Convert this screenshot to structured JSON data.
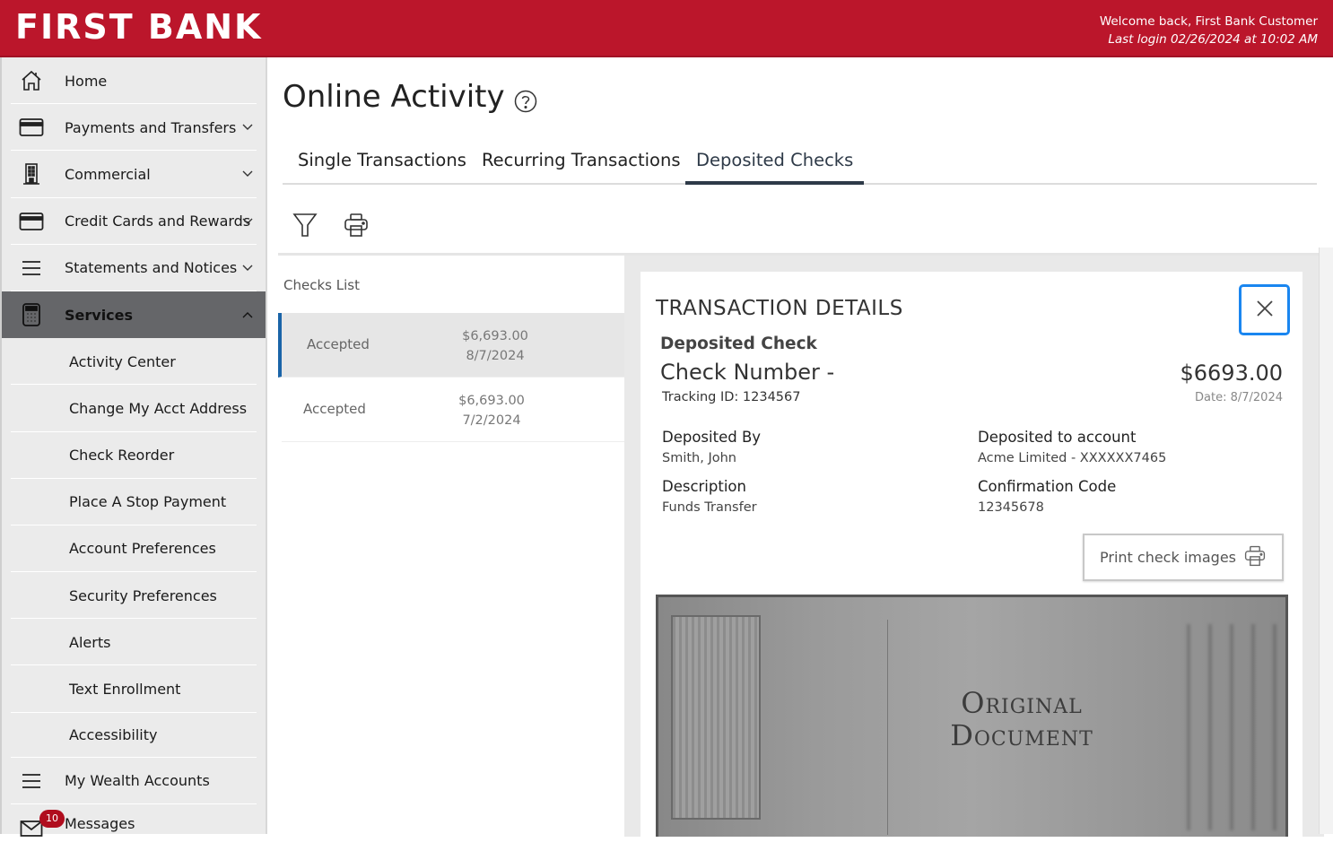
{
  "header": {
    "logo": "FIRST BANK",
    "welcome": "Welcome back, First Bank Customer",
    "last_login": "Last login 02/26/2024 at 10:02 AM",
    "brand_color": "#bb162b"
  },
  "sidebar": {
    "items": [
      {
        "label": "Home",
        "icon": "home-icon"
      },
      {
        "label": "Payments and Transfers",
        "icon": "card-icon",
        "chevron": "down"
      },
      {
        "label": "Commercial",
        "icon": "building-icon",
        "chevron": "down"
      },
      {
        "label": "Credit Cards and Rewards",
        "icon": "card-icon",
        "chevron": "down"
      },
      {
        "label": "Statements and Notices",
        "icon": "menu-icon",
        "chevron": "down"
      },
      {
        "label": "Services",
        "icon": "calculator-icon",
        "chevron": "up",
        "active": true
      }
    ],
    "services_sub": [
      {
        "label": "Activity Center"
      },
      {
        "label": "Change My Acct Address"
      },
      {
        "label": "Check Reorder"
      },
      {
        "label": "Place A Stop Payment"
      },
      {
        "label": "Account Preferences"
      },
      {
        "label": "Security Preferences"
      },
      {
        "label": "Alerts"
      },
      {
        "label": "Text Enrollment"
      },
      {
        "label": "Accessibility"
      }
    ],
    "wealth": {
      "label": "My Wealth Accounts",
      "icon": "menu-icon"
    },
    "messages": {
      "label": "Messages",
      "icon": "mail-icon",
      "badge": "10"
    }
  },
  "main": {
    "title": "Online Activity",
    "tabs": [
      {
        "label": "Single Transactions"
      },
      {
        "label": "Recurring Transactions"
      },
      {
        "label": "Deposited Checks",
        "active": true
      }
    ],
    "toolbar": {
      "filter": "filter-icon",
      "print": "printer-icon"
    },
    "checks_list": {
      "title": "Checks List",
      "rows": [
        {
          "status": "Accepted",
          "amount": "$6,693.00",
          "date": "8/7/2024",
          "selected": true
        },
        {
          "status": "Accepted",
          "amount": "$6,693.00",
          "date": "7/2/2024",
          "selected": false
        }
      ]
    },
    "details": {
      "title": "TRANSACTION DETAILS",
      "type": "Deposited Check",
      "check_number": "Check Number -",
      "tracking": "Tracking ID: 1234567",
      "amount": "$6693.00",
      "date": "Date: 8/7/2024",
      "fields": {
        "deposited_by_label": "Deposited By",
        "deposited_by": "Smith, John",
        "deposited_to_label": "Deposited to account",
        "deposited_to": "Acme Limited - XXXXXX7465",
        "description_label": "Description",
        "description": "Funds Transfer",
        "confirmation_label": "Confirmation Code",
        "confirmation": "12345678"
      },
      "print_button": "Print check images",
      "check_image_text_1": "Original",
      "check_image_text_2": "Document"
    }
  }
}
